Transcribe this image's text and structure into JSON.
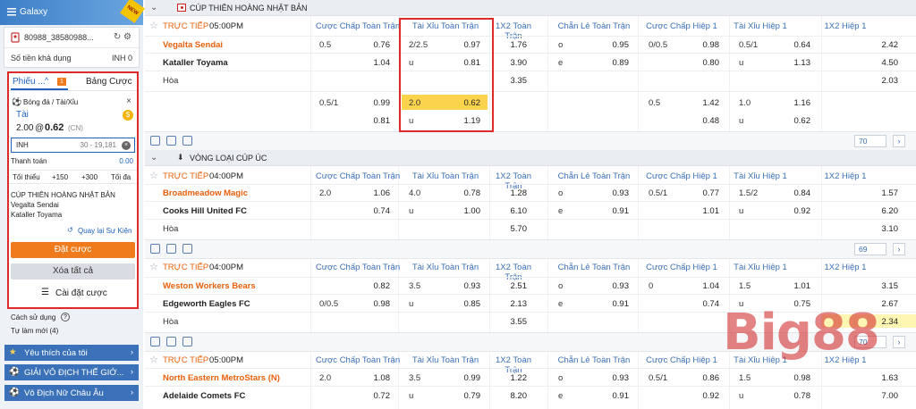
{
  "brand": {
    "banner_title": "Galaxy",
    "new_badge": "NEW",
    "watermark": "Big88"
  },
  "account": {
    "id": "80988_38580988...",
    "balance_label": "Số tiền khả dụng",
    "balance_value": "INH 0"
  },
  "betslip": {
    "tab_active": "Phiếu ...",
    "tab_active_count": "1",
    "tab_other": "Bảng Cược",
    "sport_market": "Bóng đá / Tài/Xỉu",
    "selection": "Tài",
    "odds_line": "2.00",
    "odds_at": "@",
    "odds_value": "0.62",
    "odds_type": "(CN)",
    "stake_currency": "INH",
    "stake_placeholder": "30 - 19,181",
    "payout_label": "Thanh toán",
    "payout_value": "0.00",
    "quick": [
      "Tối thiểu",
      "+150",
      "+300",
      "Tối đa"
    ],
    "league": "CÚP THIÊN HOÀNG NHẬT BẢN",
    "home": "Vegalta Sendai",
    "away": "Kataller Toyama",
    "back_link": "Quay lại Sự Kiện",
    "place_bet": "Đặt cược",
    "clear_all": "Xóa tất cả",
    "settings": "Cài đặt cược"
  },
  "left_bottom": {
    "howto": "Cách sử dụng",
    "refresh": "Tự làm mới (4)",
    "menu": [
      "Yêu thích của tôi",
      "GIẢI VÔ ĐỊCH THẾ GIỚ...",
      "Vô Địch Nữ Châu Âu"
    ]
  },
  "columns": [
    "Cược Chấp Toàn Trận",
    "Tài Xỉu Toàn Trận",
    "1X2 Toàn Trận",
    "Chẵn Lẻ Toàn Trận",
    "Cược Chấp Hiệp 1",
    "Tài Xỉu Hiệp 1",
    "1X2 Hiệp 1"
  ],
  "sections": [
    {
      "league": "CÚP THIÊN HOÀNG NHẬT BẢN",
      "page": "70"
    },
    {
      "league": "VÒNG LOẠI CÚP ÚC",
      "page": "69"
    }
  ],
  "page3": "70",
  "matches": [
    {
      "status": "TRỰC TIẾP",
      "time": "05:00PM",
      "home": "Vegalta Sendai",
      "away": "Kataller Toyama",
      "draw": "Hòa",
      "rows": [
        [
          "0.5",
          "0.76",
          "2/2.5",
          "0.97",
          "1.76",
          "o",
          "0.95",
          "0/0.5",
          "0.98",
          "0.5/1",
          "0.64",
          "2.42"
        ],
        [
          "",
          "1.04",
          "u",
          "0.81",
          "3.90",
          "e",
          "0.89",
          "",
          "0.80",
          "u",
          "1.13",
          "4.50"
        ],
        [
          "",
          "",
          "",
          "",
          "3.35",
          "",
          "",
          "",
          "",
          "",
          "",
          "2.03"
        ]
      ],
      "extra": [
        [
          "0.5/1",
          "0.99",
          "2.0",
          "0.62",
          "",
          "",
          "",
          "0.5",
          "1.42",
          "1.0",
          "1.16",
          ""
        ],
        [
          "",
          "0.81",
          "u",
          "1.19",
          "",
          "",
          "",
          "",
          "0.48",
          "u",
          "0.62",
          ""
        ]
      ]
    },
    {
      "status": "TRỰC TIẾP",
      "time": "04:00PM",
      "home": "Broadmeadow Magic",
      "away": "Cooks Hill United FC",
      "draw": "Hòa",
      "rows": [
        [
          "2.0",
          "1.06",
          "4.0",
          "0.78",
          "1.28",
          "o",
          "0.93",
          "0.5/1",
          "0.77",
          "1.5/2",
          "0.84",
          "1.57"
        ],
        [
          "",
          "0.74",
          "u",
          "1.00",
          "6.10",
          "e",
          "0.91",
          "",
          "1.01",
          "u",
          "0.92",
          "6.20"
        ],
        [
          "",
          "",
          "",
          "",
          "5.70",
          "",
          "",
          "",
          "",
          "",
          "",
          "3.10"
        ]
      ]
    },
    {
      "status": "TRỰC TIẾP",
      "time": "04:00PM",
      "home": "Weston Workers Bears",
      "away": "Edgeworth Eagles FC",
      "draw": "Hòa",
      "rows": [
        [
          "",
          "0.82",
          "3.5",
          "0.93",
          "2.51",
          "o",
          "0.93",
          "0",
          "1.04",
          "1.5",
          "1.01",
          "3.15"
        ],
        [
          "0/0.5",
          "0.98",
          "u",
          "0.85",
          "2.13",
          "e",
          "0.91",
          "",
          "0.74",
          "u",
          "0.75",
          "2.67"
        ],
        [
          "",
          "",
          "",
          "",
          "3.55",
          "",
          "",
          "",
          "",
          "",
          "",
          "2.34"
        ]
      ]
    },
    {
      "status": "TRỰC TIẾP",
      "time": "05:00PM",
      "home": "North Eastern MetroStars (N)",
      "away": "Adelaide Comets FC",
      "draw": "",
      "rows": [
        [
          "2.0",
          "1.08",
          "3.5",
          "0.99",
          "1.22",
          "o",
          "0.93",
          "0.5/1",
          "0.86",
          "1.5",
          "0.98",
          "1.63"
        ],
        [
          "",
          "0.72",
          "u",
          "0.79",
          "8.20",
          "e",
          "0.91",
          "",
          "0.92",
          "u",
          "0.78",
          "7.00"
        ]
      ]
    }
  ],
  "colors": {
    "accent": "#e8600d",
    "link": "#3b6fb5",
    "highlight": "#fcd34d",
    "selection_box": "#e02a2a"
  }
}
